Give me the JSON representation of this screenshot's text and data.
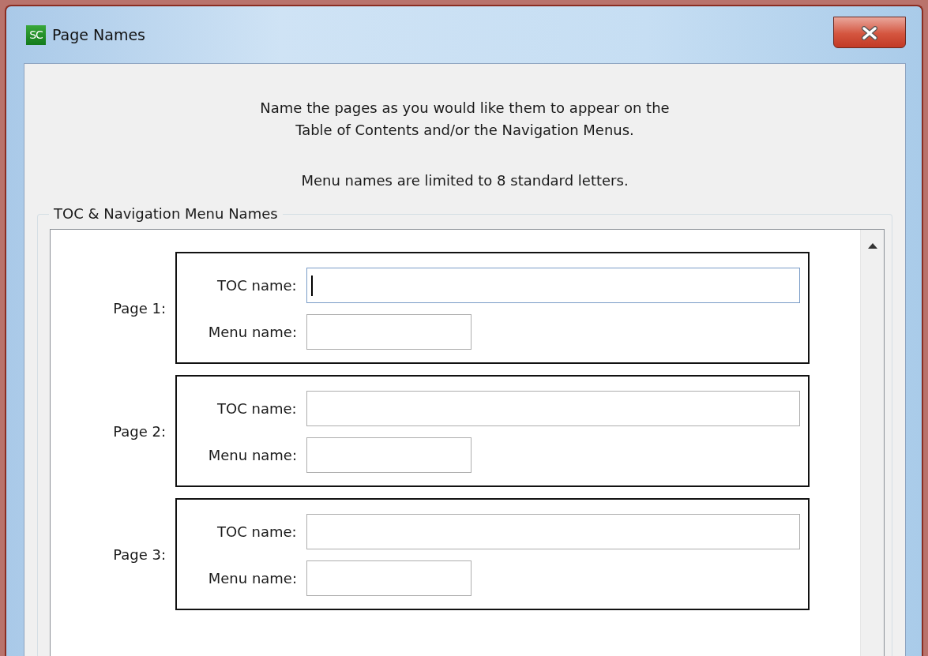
{
  "window": {
    "title": "Page Names",
    "icon_text": "SC"
  },
  "instructions": [
    {
      "lines": [
        "Name the pages as you would like them to appear on the",
        "Table of Contents and/or the Navigation Menus."
      ]
    },
    {
      "lines": [
        "Menu names are limited to 8 standard letters."
      ]
    }
  ],
  "group": {
    "legend": "TOC & Navigation Menu Names",
    "pages": [
      {
        "label": "Page 1:",
        "toc_label": "TOC name:",
        "menu_label": "Menu name:",
        "toc_focused": true
      },
      {
        "label": "Page 2:",
        "toc_label": "TOC name:",
        "menu_label": "Menu name:",
        "toc_focused": false
      },
      {
        "label": "Page 3:",
        "toc_label": "TOC name:",
        "menu_label": "Menu name:",
        "toc_focused": false
      }
    ]
  }
}
